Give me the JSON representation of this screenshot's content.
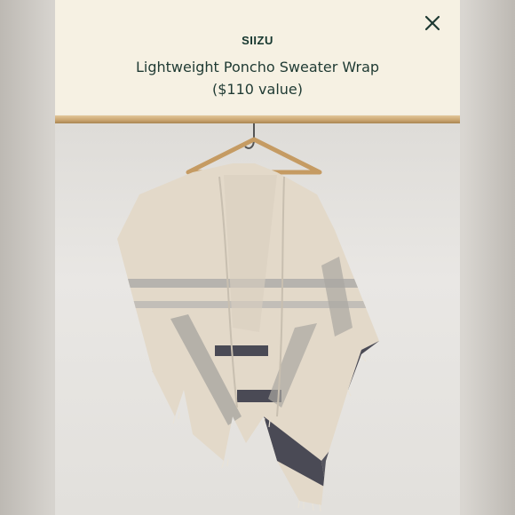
{
  "header": {
    "brand": "SIIZU",
    "title": "Lightweight Poncho Sweater Wrap",
    "value": "($110 value)"
  },
  "icons": {
    "close": "close-icon"
  },
  "photo": {
    "subject": "poncho-on-hanger"
  },
  "colors": {
    "header_bg": "#f6f1e3",
    "text": "#1f3a33",
    "brand_text": "#15362e",
    "wrap_cream": "#e3d9c9",
    "stripe_dark": "#4a4a55",
    "stripe_gray": "#9c9a97"
  }
}
